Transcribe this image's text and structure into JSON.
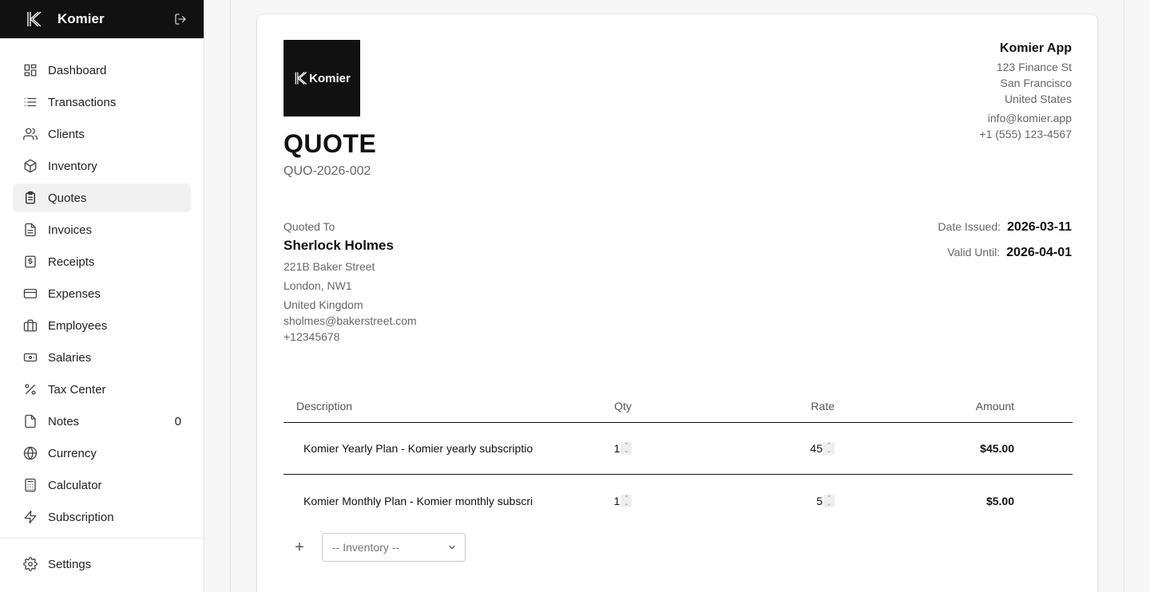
{
  "app": {
    "name": "Komier"
  },
  "sidebar": {
    "items": [
      {
        "label": "Dashboard",
        "icon": "dashboard-icon"
      },
      {
        "label": "Transactions",
        "icon": "list-icon"
      },
      {
        "label": "Clients",
        "icon": "users-icon"
      },
      {
        "label": "Inventory",
        "icon": "box-icon"
      },
      {
        "label": "Quotes",
        "icon": "clipboard-icon",
        "active": true
      },
      {
        "label": "Invoices",
        "icon": "file-text-icon"
      },
      {
        "label": "Receipts",
        "icon": "receipt-dollar-icon"
      },
      {
        "label": "Expenses",
        "icon": "credit-card-icon"
      },
      {
        "label": "Employees",
        "icon": "briefcase-icon"
      },
      {
        "label": "Salaries",
        "icon": "banknote-icon"
      },
      {
        "label": "Tax Center",
        "icon": "percent-icon"
      },
      {
        "label": "Notes",
        "icon": "note-icon",
        "count": "0"
      },
      {
        "label": "Currency",
        "icon": "globe-icon"
      },
      {
        "label": "Calculator",
        "icon": "calculator-icon"
      },
      {
        "label": "Subscription",
        "icon": "lightning-icon"
      }
    ],
    "settings_label": "Settings"
  },
  "document": {
    "logo_text": "Komier",
    "type_label": "QUOTE",
    "number": "QUO-2026-002",
    "company": {
      "name": "Komier App",
      "street": "123 Finance St",
      "city": "San Francisco",
      "country": "United States",
      "email": "info@komier.app",
      "phone": "+1 (555) 123-4567"
    },
    "quoted_to": {
      "label": "Quoted To",
      "name": "Sherlock Holmes",
      "street": "221B Baker Street",
      "city": "London, NW1",
      "country": "United Kingdom",
      "email": "sholmes@bakerstreet.com",
      "phone": "+12345678"
    },
    "dates": {
      "issued_label": "Date Issued:",
      "issued": "2026-03-11",
      "valid_label": "Valid Until:",
      "valid": "2026-04-01"
    },
    "table": {
      "headers": {
        "description": "Description",
        "qty": "Qty",
        "rate": "Rate",
        "amount": "Amount"
      },
      "rows": [
        {
          "description": "Komier Yearly Plan - Komier yearly subscriptio",
          "qty": "1",
          "rate": "45",
          "amount": "$45.00"
        },
        {
          "description": "Komier Monthly Plan - Komier monthly subscri",
          "qty": "1",
          "rate": "5",
          "amount": "$5.00"
        }
      ]
    },
    "add_item": {
      "plus": "+",
      "inventory_select": "-- Inventory --"
    }
  }
}
